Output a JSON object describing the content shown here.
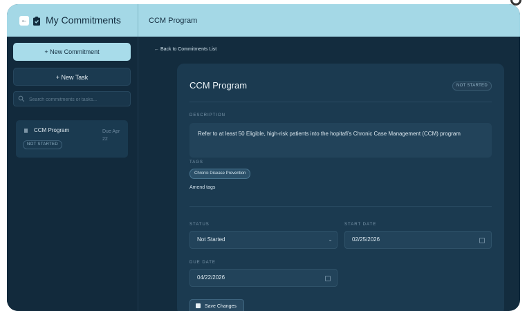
{
  "header": {
    "app_title": "My Commitments",
    "page_title": "CCM Program",
    "back_icon": "arrow-left-icon",
    "app_icon": "clipboard-icon"
  },
  "sidebar": {
    "new_commitment_label": "+ New Commitment",
    "new_task_label": "+ New Task",
    "search_placeholder": "Search commitments or tasks...",
    "items": [
      {
        "title": "CCM Program",
        "due": "Due Apr 22",
        "status": "NOT STARTED"
      }
    ]
  },
  "main": {
    "back_link": "← Back to Commitments List",
    "title": "CCM Program",
    "status_badge": "NOT STARTED",
    "description_label": "DESCRIPTION",
    "description": "Refer to at least 50 Eligible, high-risk patients into the hopitafi's Chronic Case Management (CCM) program",
    "tags_label": "TAGS",
    "tags": [
      "Chronic Disease Prevention"
    ],
    "amend_tags_label": "Amend tags",
    "status_label": "STATUS",
    "status_value": "Not Started",
    "start_date_label": "START DATE",
    "start_date": "02/25/2026",
    "due_date_label": "DUE DATE",
    "due_date": "04/22/2026",
    "save_label": "Save Changes"
  },
  "colors": {
    "background": "#132c3e",
    "topbar": "#a4d8e6",
    "panel": "#1b3a50",
    "accent": "#a8dcea"
  }
}
